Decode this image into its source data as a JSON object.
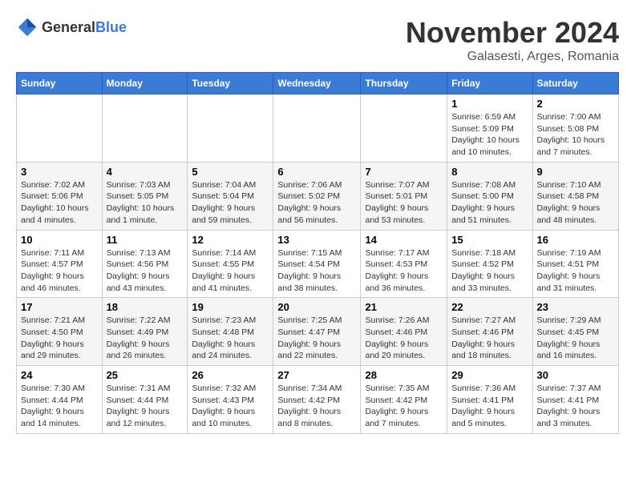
{
  "header": {
    "logo_general": "General",
    "logo_blue": "Blue",
    "month_title": "November 2024",
    "location": "Galasesti, Arges, Romania"
  },
  "weekdays": [
    "Sunday",
    "Monday",
    "Tuesday",
    "Wednesday",
    "Thursday",
    "Friday",
    "Saturday"
  ],
  "weeks": [
    [
      {
        "day": "",
        "detail": ""
      },
      {
        "day": "",
        "detail": ""
      },
      {
        "day": "",
        "detail": ""
      },
      {
        "day": "",
        "detail": ""
      },
      {
        "day": "",
        "detail": ""
      },
      {
        "day": "1",
        "detail": "Sunrise: 6:59 AM\nSunset: 5:09 PM\nDaylight: 10 hours and 10 minutes."
      },
      {
        "day": "2",
        "detail": "Sunrise: 7:00 AM\nSunset: 5:08 PM\nDaylight: 10 hours and 7 minutes."
      }
    ],
    [
      {
        "day": "3",
        "detail": "Sunrise: 7:02 AM\nSunset: 5:06 PM\nDaylight: 10 hours and 4 minutes."
      },
      {
        "day": "4",
        "detail": "Sunrise: 7:03 AM\nSunset: 5:05 PM\nDaylight: 10 hours and 1 minute."
      },
      {
        "day": "5",
        "detail": "Sunrise: 7:04 AM\nSunset: 5:04 PM\nDaylight: 9 hours and 59 minutes."
      },
      {
        "day": "6",
        "detail": "Sunrise: 7:06 AM\nSunset: 5:02 PM\nDaylight: 9 hours and 56 minutes."
      },
      {
        "day": "7",
        "detail": "Sunrise: 7:07 AM\nSunset: 5:01 PM\nDaylight: 9 hours and 53 minutes."
      },
      {
        "day": "8",
        "detail": "Sunrise: 7:08 AM\nSunset: 5:00 PM\nDaylight: 9 hours and 51 minutes."
      },
      {
        "day": "9",
        "detail": "Sunrise: 7:10 AM\nSunset: 4:58 PM\nDaylight: 9 hours and 48 minutes."
      }
    ],
    [
      {
        "day": "10",
        "detail": "Sunrise: 7:11 AM\nSunset: 4:57 PM\nDaylight: 9 hours and 46 minutes."
      },
      {
        "day": "11",
        "detail": "Sunrise: 7:13 AM\nSunset: 4:56 PM\nDaylight: 9 hours and 43 minutes."
      },
      {
        "day": "12",
        "detail": "Sunrise: 7:14 AM\nSunset: 4:55 PM\nDaylight: 9 hours and 41 minutes."
      },
      {
        "day": "13",
        "detail": "Sunrise: 7:15 AM\nSunset: 4:54 PM\nDaylight: 9 hours and 38 minutes."
      },
      {
        "day": "14",
        "detail": "Sunrise: 7:17 AM\nSunset: 4:53 PM\nDaylight: 9 hours and 36 minutes."
      },
      {
        "day": "15",
        "detail": "Sunrise: 7:18 AM\nSunset: 4:52 PM\nDaylight: 9 hours and 33 minutes."
      },
      {
        "day": "16",
        "detail": "Sunrise: 7:19 AM\nSunset: 4:51 PM\nDaylight: 9 hours and 31 minutes."
      }
    ],
    [
      {
        "day": "17",
        "detail": "Sunrise: 7:21 AM\nSunset: 4:50 PM\nDaylight: 9 hours and 29 minutes."
      },
      {
        "day": "18",
        "detail": "Sunrise: 7:22 AM\nSunset: 4:49 PM\nDaylight: 9 hours and 26 minutes."
      },
      {
        "day": "19",
        "detail": "Sunrise: 7:23 AM\nSunset: 4:48 PM\nDaylight: 9 hours and 24 minutes."
      },
      {
        "day": "20",
        "detail": "Sunrise: 7:25 AM\nSunset: 4:47 PM\nDaylight: 9 hours and 22 minutes."
      },
      {
        "day": "21",
        "detail": "Sunrise: 7:26 AM\nSunset: 4:46 PM\nDaylight: 9 hours and 20 minutes."
      },
      {
        "day": "22",
        "detail": "Sunrise: 7:27 AM\nSunset: 4:46 PM\nDaylight: 9 hours and 18 minutes."
      },
      {
        "day": "23",
        "detail": "Sunrise: 7:29 AM\nSunset: 4:45 PM\nDaylight: 9 hours and 16 minutes."
      }
    ],
    [
      {
        "day": "24",
        "detail": "Sunrise: 7:30 AM\nSunset: 4:44 PM\nDaylight: 9 hours and 14 minutes."
      },
      {
        "day": "25",
        "detail": "Sunrise: 7:31 AM\nSunset: 4:44 PM\nDaylight: 9 hours and 12 minutes."
      },
      {
        "day": "26",
        "detail": "Sunrise: 7:32 AM\nSunset: 4:43 PM\nDaylight: 9 hours and 10 minutes."
      },
      {
        "day": "27",
        "detail": "Sunrise: 7:34 AM\nSunset: 4:42 PM\nDaylight: 9 hours and 8 minutes."
      },
      {
        "day": "28",
        "detail": "Sunrise: 7:35 AM\nSunset: 4:42 PM\nDaylight: 9 hours and 7 minutes."
      },
      {
        "day": "29",
        "detail": "Sunrise: 7:36 AM\nSunset: 4:41 PM\nDaylight: 9 hours and 5 minutes."
      },
      {
        "day": "30",
        "detail": "Sunrise: 7:37 AM\nSunset: 4:41 PM\nDaylight: 9 hours and 3 minutes."
      }
    ]
  ]
}
